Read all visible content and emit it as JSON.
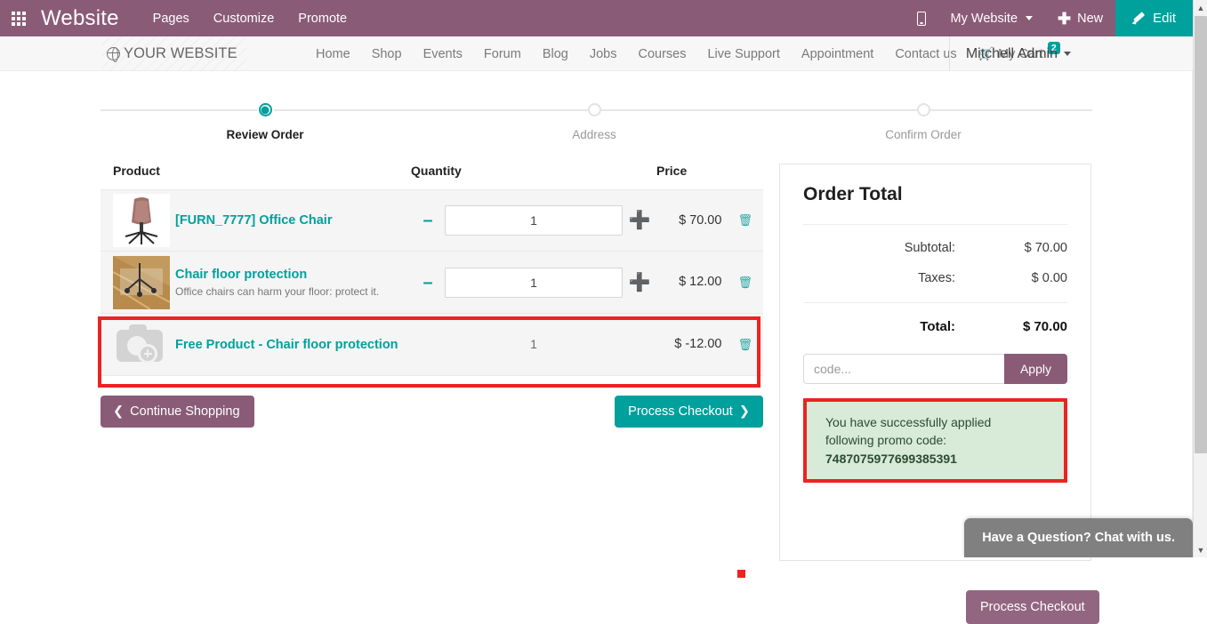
{
  "backend_bar": {
    "apps_icon": "apps-grid-icon",
    "brand": "Website",
    "menu": [
      "Pages",
      "Customize",
      "Promote"
    ],
    "mobile_preview_icon": "mobile-phone-icon",
    "website_selector": "My Website",
    "new_label": "New",
    "edit_label": "Edit",
    "accent": "#8a5b77",
    "edit_accent": "#00a09d"
  },
  "site_header": {
    "logo_icon": "globe-icon",
    "logo_text": "YOUR WEBSITE",
    "nav": [
      "Home",
      "Shop",
      "Events",
      "Forum",
      "Blog",
      "Jobs",
      "Courses",
      "Live Support",
      "Appointment",
      "Contact us"
    ],
    "cart_label": "My Cart",
    "cart_count": "2",
    "user_name": "Mitchell Admin"
  },
  "stepper": {
    "steps": [
      {
        "label": "Review Order",
        "state": "active"
      },
      {
        "label": "Address",
        "state": "pending"
      },
      {
        "label": "Confirm Order",
        "state": "pending"
      }
    ]
  },
  "cart": {
    "columns": {
      "product": "Product",
      "quantity": "Quantity",
      "price": "Price"
    },
    "rows": [
      {
        "name": "[FURN_7777] Office Chair",
        "description": "",
        "quantity": "1",
        "price": "$ 70.00",
        "thumb": "office-chair-photo",
        "editable_qty": true,
        "highlighted": false
      },
      {
        "name": "Chair floor protection",
        "description": "Office chairs can harm your floor: protect it.",
        "quantity": "1",
        "price": "$ 12.00",
        "thumb": "chair-floor-protection-photo",
        "editable_qty": true,
        "highlighted": false
      },
      {
        "name": "Free Product - Chair floor protection",
        "description": "",
        "quantity": "1",
        "price": "$ -12.00",
        "thumb": "image-placeholder-icon",
        "editable_qty": false,
        "highlighted": true
      }
    ],
    "minus_icon": "minus-icon",
    "plus_icon": "plus-icon",
    "delete_icon": "trash-icon",
    "continue_shopping": "Continue Shopping",
    "process_checkout": "Process Checkout"
  },
  "order_total": {
    "title": "Order Total",
    "lines": [
      {
        "label": "Subtotal:",
        "value": "$ 70.00",
        "bold": false
      },
      {
        "label": "Taxes:",
        "value": "$ 0.00",
        "bold": false
      }
    ],
    "total_label": "Total:",
    "total_value": "$ 70.00",
    "promo_placeholder": "code...",
    "promo_value": "",
    "apply_label": "Apply",
    "alert_line1": "You have successfully applied",
    "alert_line2": "following promo code:",
    "alert_code": "7487075977699385391",
    "alert_bg": "#d8ead8",
    "highlight_color": "#ee2222",
    "bottom_checkout": "Process Checkout"
  },
  "chat_widget": {
    "text": "Have a Question? Chat with us."
  },
  "scrollbar": {
    "up_arrow": "chevron-up-icon",
    "down_arrow": "chevron-down-icon"
  }
}
